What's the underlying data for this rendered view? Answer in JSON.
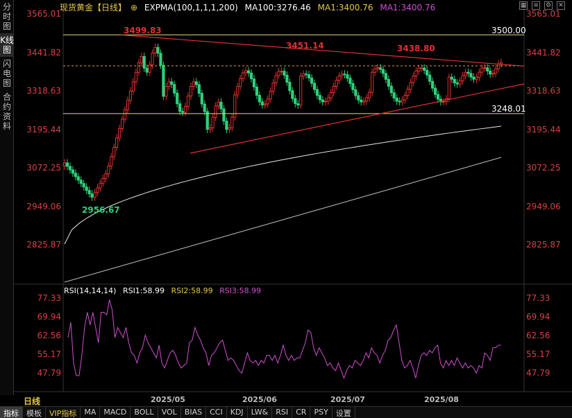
{
  "sidebar": {
    "tabs": [
      {
        "label": "分时图",
        "active": false
      },
      {
        "label": "K线图",
        "active": true
      },
      {
        "label": "闪电图",
        "active": false
      },
      {
        "label": "合约资料",
        "active": false
      }
    ]
  },
  "header": {
    "title": "现货黄金【日线】",
    "expma": "EXPMA(100,1,1,1,200)",
    "ma100": "MA100:3276.46",
    "ma1a": "MA1:3400.76",
    "ma1b": "MA1:3400.76"
  },
  "price_axis": {
    "left": [
      "3565.01",
      "3441.82",
      "3318.63",
      "3195.44",
      "3072.25",
      "2949.06",
      "2825.87"
    ],
    "right": [
      "3565.01",
      "3441.82",
      "3318.63",
      "3195.44",
      "3072.25",
      "2949.06",
      "2825.87"
    ]
  },
  "annotations": {
    "high1": "3499.83",
    "high2": "3451.14",
    "high3": "3438.80",
    "low1": "2956.67",
    "line_upper": "3500.00",
    "line_lower": "3248.01"
  },
  "rsi": {
    "label": "RSI(14,14,14)",
    "rsi1": "RSI1:58.99",
    "rsi2": "RSI2:58.99",
    "rsi3": "RSI3:58.99",
    "axis": [
      "77.33",
      "69.94",
      "62.56",
      "55.17",
      "47.79"
    ]
  },
  "x_axis": {
    "period": "日线",
    "dates": [
      "2025/05",
      "2025/06",
      "2025/07",
      "2025/08"
    ]
  },
  "bottom_tabs": [
    {
      "label": "指标",
      "active": true,
      "vip": false
    },
    {
      "label": "模板",
      "active": false,
      "vip": false
    },
    {
      "label": "VIP指标",
      "active": false,
      "vip": true
    },
    {
      "label": "MA",
      "active": false,
      "vip": false
    },
    {
      "label": "MACD",
      "active": false,
      "vip": false
    },
    {
      "label": "BOLL",
      "active": false,
      "vip": false
    },
    {
      "label": "VOL",
      "active": false,
      "vip": false
    },
    {
      "label": "BIAS",
      "active": false,
      "vip": false
    },
    {
      "label": "CCI",
      "active": false,
      "vip": false
    },
    {
      "label": "KDJ",
      "active": false,
      "vip": false
    },
    {
      "label": "LW&",
      "active": false,
      "vip": false
    },
    {
      "label": "RSI",
      "active": false,
      "vip": false
    },
    {
      "label": "CR",
      "active": false,
      "vip": false
    },
    {
      "label": "PSY",
      "active": false,
      "vip": false
    },
    {
      "label": "设置",
      "active": false,
      "vip": false
    }
  ],
  "colors": {
    "up": "#e03030",
    "down": "#2fd07a",
    "axis_text": "#d94141",
    "gold": "#e6c84a",
    "rsi": "#d050d0"
  },
  "chart_data": {
    "type": "candlestick",
    "ylim": [
      2825.87,
      3565.01
    ],
    "rsi_values": [
      62,
      68,
      52,
      47,
      47,
      55,
      66,
      72,
      67,
      72,
      66,
      60,
      72,
      72,
      71,
      77,
      73,
      62,
      66,
      64,
      62,
      66,
      60,
      56,
      55,
      52,
      56,
      58,
      63,
      60,
      58,
      56,
      54,
      59,
      52,
      50,
      53,
      56,
      57,
      55,
      52,
      50,
      51,
      52,
      60,
      61,
      66,
      63,
      61,
      58,
      56,
      51,
      55,
      56,
      58,
      60,
      61,
      57,
      53,
      54,
      53,
      51,
      49,
      48,
      52,
      56,
      53,
      52,
      53,
      51,
      53,
      52,
      55,
      55,
      53,
      55,
      52,
      55,
      59,
      55,
      53,
      55,
      53,
      54,
      54,
      57,
      60,
      65,
      64,
      58,
      55,
      58,
      56,
      54,
      51,
      52,
      50,
      49,
      52,
      49,
      46,
      49,
      51,
      50,
      53,
      52,
      51,
      53,
      56,
      54,
      58,
      56,
      55,
      52,
      55,
      57,
      61,
      62,
      65,
      67,
      60,
      53,
      50,
      51,
      53,
      50,
      46,
      51,
      55,
      56,
      55,
      57,
      56,
      58,
      59,
      52,
      50,
      53,
      51,
      53,
      51,
      54,
      52,
      50,
      52,
      50,
      51,
      50,
      48,
      51,
      50,
      56,
      55,
      53,
      58,
      58,
      59,
      59
    ]
  }
}
